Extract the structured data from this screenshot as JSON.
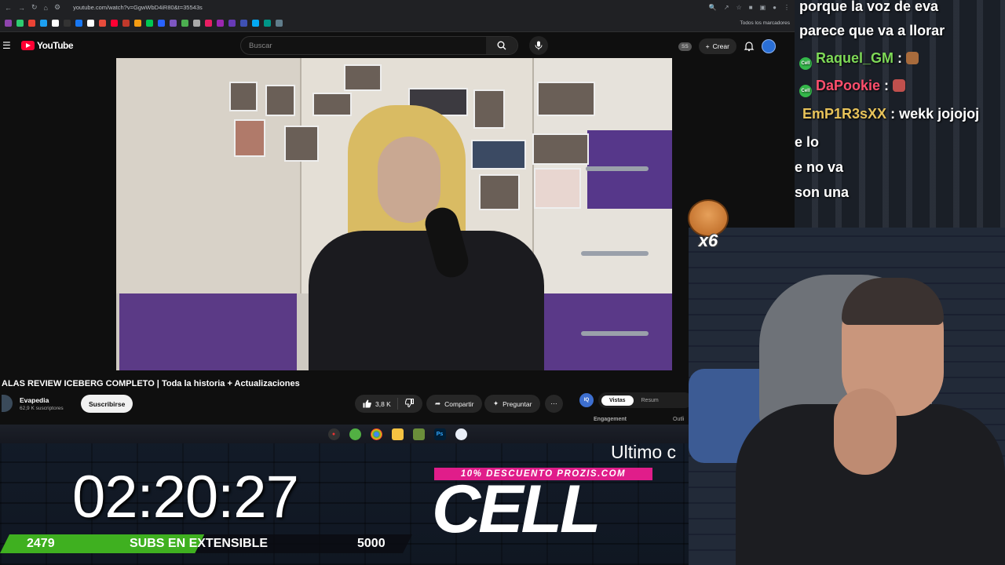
{
  "browser": {
    "url": "youtube.com/watch?v=GgwWbD4iR80&t=35543s",
    "bookmarks_all": "Todos los marcadores",
    "bookmark_colors": [
      "#8e44ad",
      "#2ecc71",
      "#ea4335",
      "#1da1f2",
      "#fff",
      "#333",
      "#1877f2",
      "#fff",
      "#e74c3c",
      "#ff0033",
      "#c0392b",
      "#f39c12",
      "#00c853",
      "#2962ff",
      "#7e57c2",
      "#4caf50",
      "#aaa",
      "#e91e63",
      "#9c27b0",
      "#673ab7",
      "#3f51b5",
      "#03a9f4",
      "#009688",
      "#607d8b"
    ]
  },
  "youtube": {
    "logo_text": "YouTube",
    "search_placeholder": "Buscar",
    "ss_badge": "SS",
    "create_label": "Crear"
  },
  "video": {
    "title": "ALAS REVIEW ICEBERG COMPLETO | Toda la historia + Actualizaciones",
    "channel_name": "Evapedia",
    "channel_subs": "62,9 K suscriptores",
    "subscribe_label": "Suscribirse",
    "likes": "3,8 K",
    "share_label": "Compartir",
    "ask_label": "Preguntar"
  },
  "side_panel": {
    "icon_label": "IQ",
    "tab_active": "Vistas",
    "tab_other": "Resum",
    "engagement_label": "Engagement",
    "outline_label": "Outli"
  },
  "chat": {
    "messages": [
      {
        "user": "",
        "text": "porque la voz de eva",
        "color": "#ffffff"
      },
      {
        "user": "",
        "text": "parece que va a llorar",
        "color": "#ffffff"
      },
      {
        "user": "Raquel_GM",
        "text": ":",
        "color": "#7ed957"
      },
      {
        "user": "DaPookie",
        "text": ":",
        "color": "#ff4f6d"
      },
      {
        "user": "EmP1R3sXX",
        "text": ": wekk jojojoj",
        "color": "#e8c35a"
      },
      {
        "user": "",
        "text": "e lo",
        "color": "#ffffff"
      },
      {
        "user": "",
        "text": "e no va",
        "color": "#ffffff"
      },
      {
        "user": "",
        "text": "son una",
        "color": "#ffffff"
      }
    ],
    "badge_label": "Cell"
  },
  "sticker": {
    "multiplier": "x6"
  },
  "overlay": {
    "timer": "02:20:27",
    "subs_current": "2479",
    "subs_label": "SUBS EN EXTENSIBLE",
    "subs_target": "5000",
    "subs_progress": 0.4958,
    "ultimo_text": "Ultimo c",
    "promo_text": "10% DESCUENTO PROZIS.COM",
    "brand_text": "CELL"
  },
  "taskbar": {
    "items": [
      "obs",
      "xbox",
      "chrome",
      "folder",
      "minecraft",
      "photoshop",
      "paint"
    ]
  }
}
